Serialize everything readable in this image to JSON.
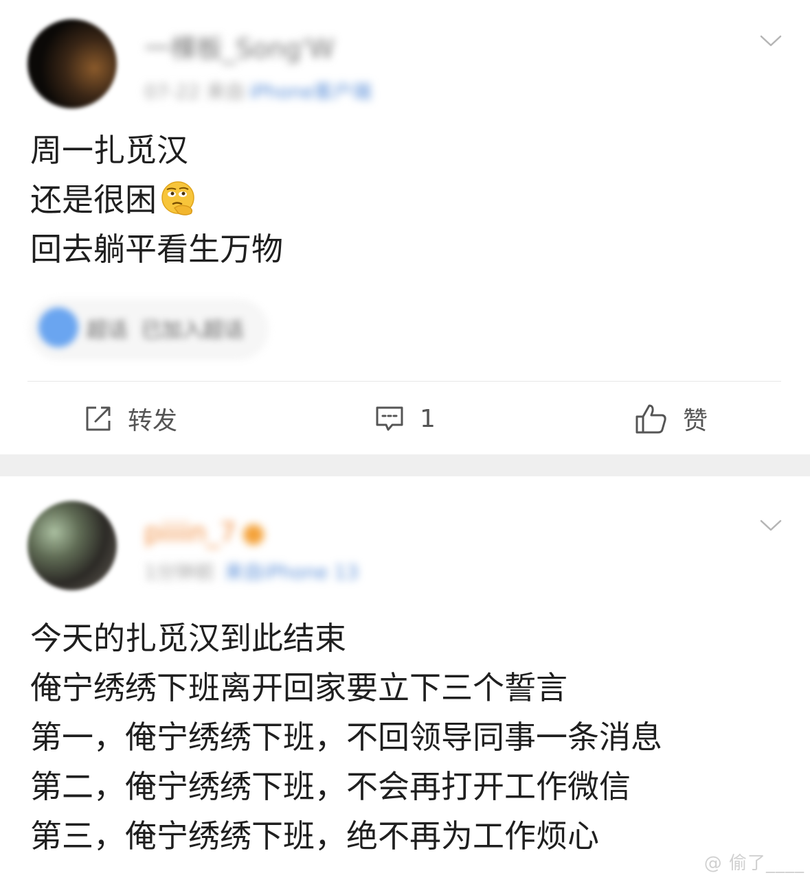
{
  "post1": {
    "username": "一棵板_Song'W",
    "meta_time": "07-22 来自",
    "meta_source": "iPhone客户端",
    "lines": [
      "周一扎觅汉",
      "还是很困",
      "回去躺平看生万物"
    ],
    "emoji": "thinking-face",
    "supertopic": {
      "name": "超话",
      "info": "已加入超话"
    },
    "actions": {
      "repost": "转发",
      "comment": "1",
      "like": "赞"
    }
  },
  "post2": {
    "username": "piiiin_7",
    "meta_time": "1分钟前",
    "meta_source": "来自iPhone 13",
    "lines": [
      "今天的扎觅汉到此结束",
      "俺宁绣绣下班离开回家要立下三个誓言",
      "第一，俺宁绣绣下班，不回领导同事一条消息",
      "第二，俺宁绣绣下班，不会再打开工作微信",
      "第三，俺宁绣绣下班，绝不再为工作烦心"
    ]
  },
  "watermark": "@ 偷了____",
  "colors": {
    "accent_orange": "#f08a3a",
    "link_blue": "#5b8fd8",
    "separator": "#efefef"
  }
}
